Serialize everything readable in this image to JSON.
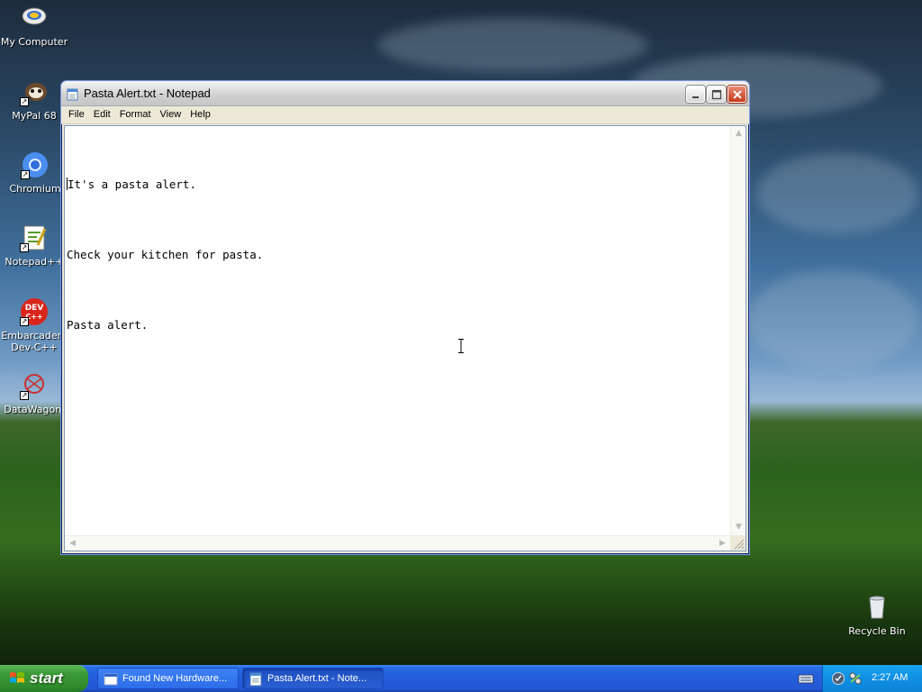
{
  "desktop": {
    "icons": [
      {
        "label": "My Computer"
      },
      {
        "label": "MyPal 68"
      },
      {
        "label": "Chromium"
      },
      {
        "label": "Notepad++"
      },
      {
        "label": "Embarcadero Dev-C++",
        "line1": "Embarcadero",
        "line2": "Dev-C++"
      },
      {
        "label": "DataWagon."
      },
      {
        "label": "Recycle Bin"
      }
    ],
    "dev_icon_text": "DEV",
    "dev_icon_sub": "C++"
  },
  "window": {
    "title": "Pasta Alert.txt - Notepad",
    "menu": [
      "File",
      "Edit",
      "Format",
      "View",
      "Help"
    ],
    "lines": [
      "It's a pasta alert.",
      "Check your kitchen for pasta.",
      "Pasta alert."
    ]
  },
  "taskbar": {
    "start_label": "start",
    "tasks": [
      {
        "label": "Found New Hardware..."
      },
      {
        "label": "Pasta Alert.txt - Note..."
      }
    ],
    "clock": "2:27 AM"
  }
}
